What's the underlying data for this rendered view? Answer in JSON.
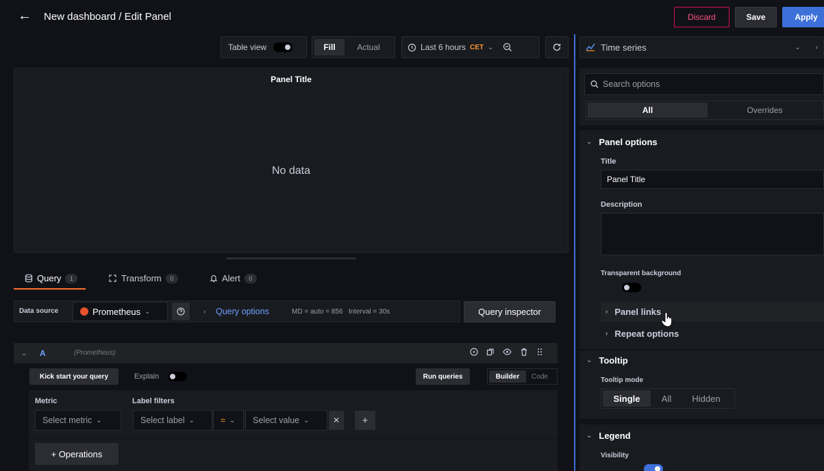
{
  "header": {
    "breadcrumb": "New dashboard / Edit Panel",
    "discard_label": "Discard",
    "save_label": "Save",
    "apply_label": "Apply"
  },
  "toolbar": {
    "table_view_label": "Table view",
    "fill_label": "Fill",
    "actual_label": "Actual",
    "time_range": "Last 6 hours",
    "timezone": "CET"
  },
  "panel": {
    "title": "Panel Title",
    "empty_message": "No data"
  },
  "tabs": [
    {
      "label": "Query",
      "count": "1"
    },
    {
      "label": "Transform",
      "count": "0"
    },
    {
      "label": "Alert",
      "count": "0"
    }
  ],
  "datasource": {
    "label": "Data source",
    "value": "Prometheus",
    "query_options_label": "Query options",
    "query_options_info": "MD = auto = 856   Interval = 30s",
    "query_inspector_label": "Query inspector"
  },
  "query": {
    "ref_id": "A",
    "source_name": "(Prometheus)",
    "kick_start_label": "Kick start your query",
    "explain_label": "Explain",
    "run_queries_label": "Run queries",
    "builder_label": "Builder",
    "code_label": "Code",
    "metric_label": "Metric",
    "metric_placeholder": "Select metric",
    "label_filters_label": "Label filters",
    "label_placeholder": "Select label",
    "operator": "=",
    "value_placeholder": "Select value",
    "operations_label": "+ Operations"
  },
  "options": {
    "visualization": "Time series",
    "search_placeholder": "Search options",
    "tab_all": "All",
    "tab_overrides": "Overrides",
    "panel_options_title": "Panel options",
    "title_label": "Title",
    "title_value": "Panel Title",
    "description_label": "Description",
    "transparent_label": "Transparent background",
    "panel_links_label": "Panel links",
    "repeat_options_label": "Repeat options",
    "tooltip_title": "Tooltip",
    "tooltip_mode_label": "Tooltip mode",
    "tooltip_modes": [
      "Single",
      "All",
      "Hidden"
    ],
    "legend_title": "Legend",
    "visibility_label": "Visibility"
  },
  "colors": {
    "accent": "#3d71d9",
    "discard": "#ff5286",
    "prometheus": "#e6522c",
    "timezone": "#ff9830"
  }
}
